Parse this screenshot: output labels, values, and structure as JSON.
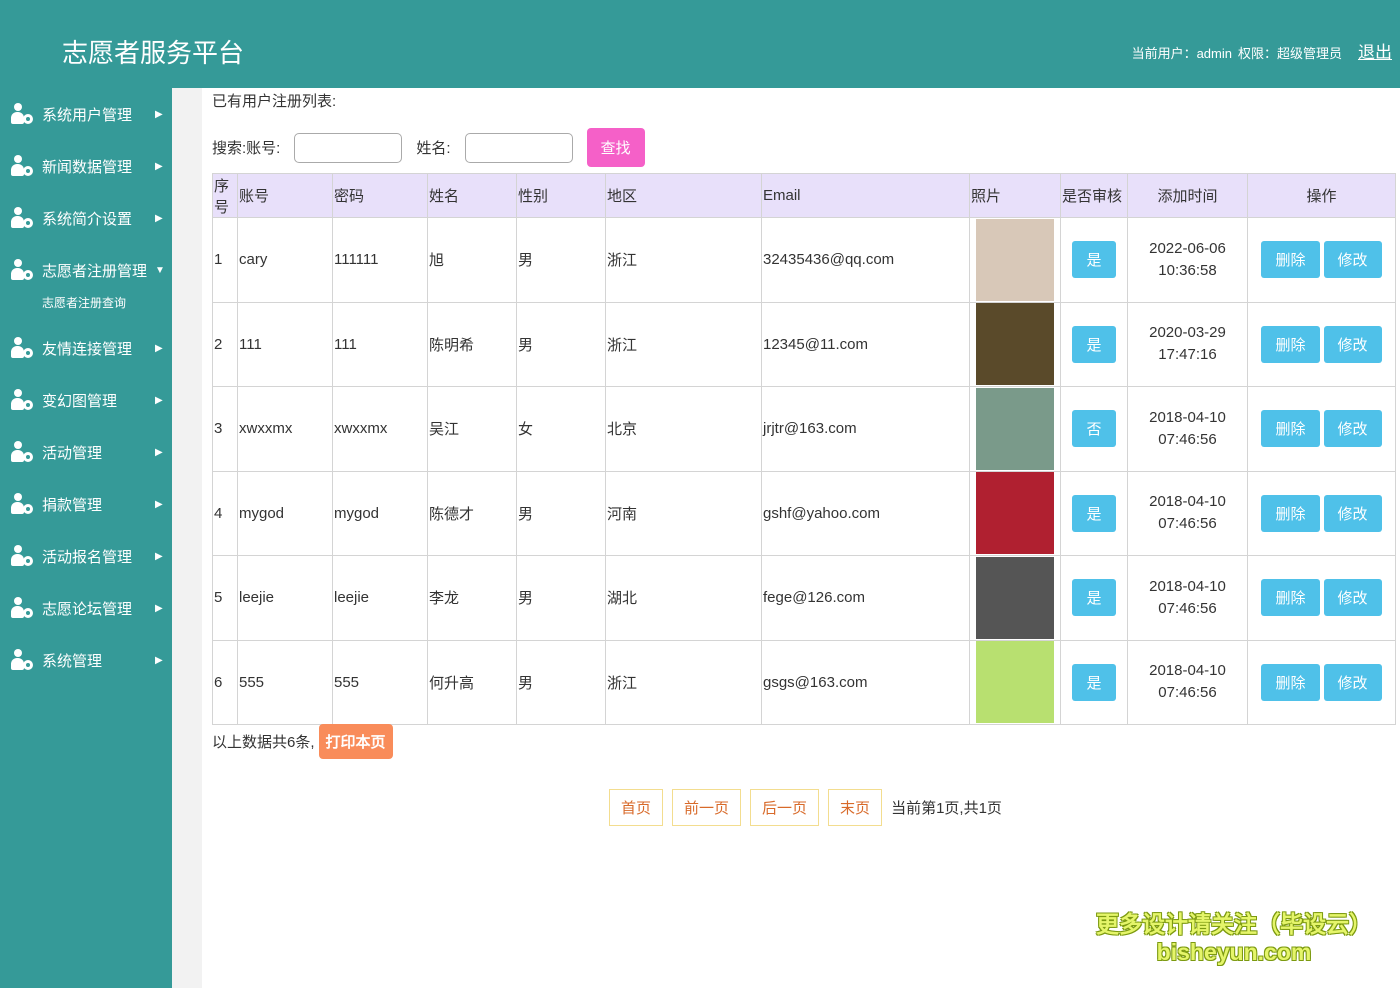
{
  "header": {
    "title": "志愿者服务平台",
    "user_label": "当前用户：admin",
    "role_label": "权限：超级管理员",
    "logout": "退出"
  },
  "sidebar": {
    "items": [
      {
        "label": "系统用户管理"
      },
      {
        "label": "新闻数据管理"
      },
      {
        "label": "系统简介设置"
      },
      {
        "label": "志愿者注册管理",
        "expanded": true,
        "sub": "志愿者注册查询"
      },
      {
        "label": "友情连接管理"
      },
      {
        "label": "变幻图管理"
      },
      {
        "label": "活动管理"
      },
      {
        "label": "捐款管理"
      },
      {
        "label": "活动报名管理"
      },
      {
        "label": "志愿论坛管理"
      },
      {
        "label": "系统管理"
      }
    ]
  },
  "main": {
    "list_title": "已有用户注册列表:",
    "search_account_label": "搜索:账号:",
    "search_name_label": "姓名:",
    "search_account_value": "",
    "search_name_value": "",
    "find_button": "查找",
    "columns": [
      "序号",
      "账号",
      "密码",
      "姓名",
      "性别",
      "地区",
      "Email",
      "照片",
      "是否审核",
      "添加时间",
      "操作"
    ],
    "rows": [
      {
        "no": "1",
        "account": "cary",
        "password": "111111",
        "name": "旭",
        "gender": "男",
        "region": "浙江",
        "email": "32435436@qq.com",
        "photo_color": "#d8c8b8",
        "approved": "是",
        "date": "2022-06-06",
        "time": "10:36:58"
      },
      {
        "no": "2",
        "account": "111",
        "password": "111",
        "name": "陈明希",
        "gender": "男",
        "region": "浙江",
        "email": "12345@11.com",
        "photo_color": "#5a4a2a",
        "approved": "是",
        "date": "2020-03-29",
        "time": "17:47:16"
      },
      {
        "no": "3",
        "account": "xwxxmx",
        "password": "xwxxmx",
        "name": "吴江",
        "gender": "女",
        "region": "北京",
        "email": "jrjtr@163.com",
        "photo_color": "#7a9a8a",
        "approved": "否",
        "date": "2018-04-10",
        "time": "07:46:56"
      },
      {
        "no": "4",
        "account": "mygod",
        "password": "mygod",
        "name": "陈德才",
        "gender": "男",
        "region": "河南",
        "email": "gshf@yahoo.com",
        "photo_color": "#b02030",
        "approved": "是",
        "date": "2018-04-10",
        "time": "07:46:56"
      },
      {
        "no": "5",
        "account": "leejie",
        "password": "leejie",
        "name": "李龙",
        "gender": "男",
        "region": "湖北",
        "email": "fege@126.com",
        "photo_color": "#555555",
        "approved": "是",
        "date": "2018-04-10",
        "time": "07:46:56"
      },
      {
        "no": "6",
        "account": "555",
        "password": "555",
        "name": "何升高",
        "gender": "男",
        "region": "浙江",
        "email": "gsgs@163.com",
        "photo_color": "#b8e070",
        "approved": "是",
        "date": "2018-04-10",
        "time": "07:46:56"
      }
    ],
    "delete_label": "删除",
    "edit_label": "修改",
    "total_text": "以上数据共6条,",
    "print_button": "打印本页",
    "pager": {
      "first": "首页",
      "prev": "前一页",
      "next": "后一页",
      "last": "末页",
      "status": "当前第1页,共1页"
    }
  },
  "watermark": {
    "line1": "更多设计请关注（毕设云）",
    "line2": "bisheyun.com"
  }
}
